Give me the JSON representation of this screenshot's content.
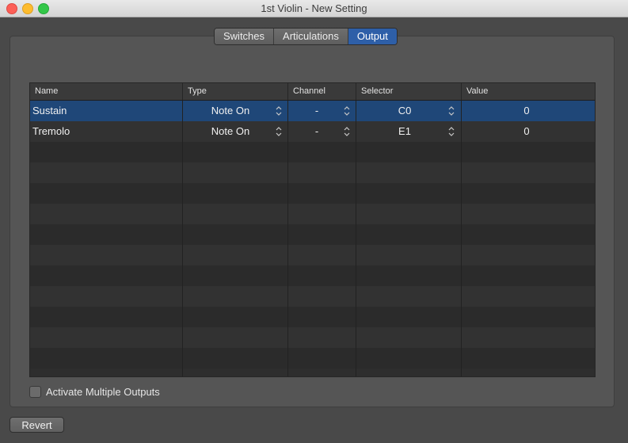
{
  "window": {
    "title": "1st Violin - New Setting"
  },
  "tabs": [
    {
      "label": "Switches",
      "active": false
    },
    {
      "label": "Articulations",
      "active": false
    },
    {
      "label": "Output",
      "active": true
    }
  ],
  "table": {
    "headers": [
      "Name",
      "Type",
      "Channel",
      "Selector",
      "Value"
    ],
    "rows": [
      {
        "name": "Sustain",
        "type": "Note On",
        "channel": "-",
        "selector": "C0",
        "value": "0",
        "selected": true
      },
      {
        "name": "Tremolo",
        "type": "Note On",
        "channel": "-",
        "selector": "E1",
        "value": "0",
        "selected": false
      }
    ]
  },
  "options": {
    "activate_multiple_outputs_label": "Activate Multiple Outputs",
    "activate_multiple_outputs_checked": false
  },
  "buttons": {
    "revert_label": "Revert"
  },
  "colors": {
    "accent": "#2e5fa8",
    "selected_row": "#1f4778"
  },
  "icons": {
    "stepper": "up-down-chevron-icon"
  }
}
